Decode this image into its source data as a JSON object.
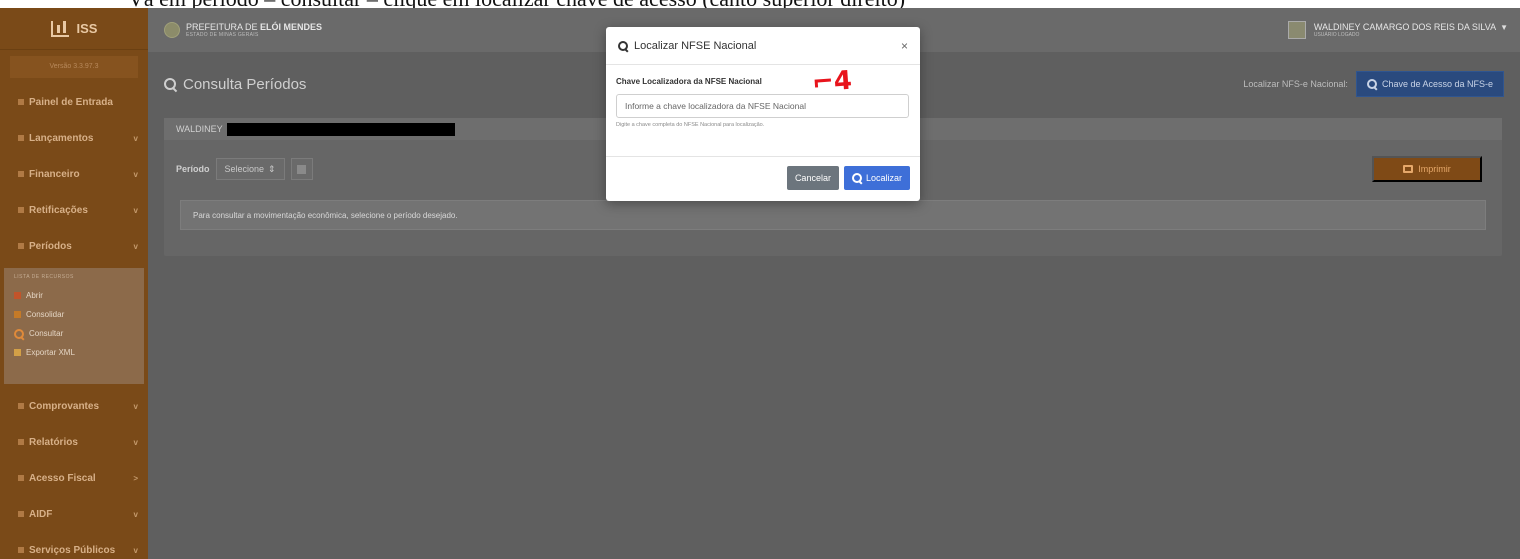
{
  "caption": "Vá em período – consultar – clique em localizar chave de acesso (canto superior direito)",
  "sidebar": {
    "app_name": "ISS",
    "version": "Versão 3.3.97.3",
    "items_top": [
      {
        "label": "Painel de Entrada",
        "chevron": ""
      },
      {
        "label": "Lançamentos",
        "chevron": "v"
      },
      {
        "label": "Financeiro",
        "chevron": "v"
      },
      {
        "label": "Retificações",
        "chevron": "v"
      },
      {
        "label": "Períodos",
        "chevron": "v"
      }
    ],
    "submenu": {
      "title": "LISTA DE RECURSOS",
      "items": [
        {
          "label": "Abrir",
          "icon": "red-square-icon"
        },
        {
          "label": "Consolidar",
          "icon": "orange-square-icon"
        },
        {
          "label": "Consultar",
          "icon": "search-icon"
        },
        {
          "label": "Exportar XML",
          "icon": "file-icon"
        }
      ]
    },
    "items_bottom": [
      {
        "label": "Comprovantes",
        "chevron": "v"
      },
      {
        "label": "Relatórios",
        "chevron": "v"
      },
      {
        "label": "Acesso Fiscal",
        "chevron": ">"
      },
      {
        "label": "AIDF",
        "chevron": "v"
      },
      {
        "label": "Serviços Públicos",
        "chevron": "v"
      }
    ]
  },
  "header": {
    "org_prefix": "PREFEITURA DE ",
    "org_name": "ELÓI MENDES",
    "org_state": "ESTADO DE MINAS GERAIS",
    "user_name": "WALDINEY CAMARGO DOS REIS DA SILVA",
    "user_role": "USUÁRIO LOGADO"
  },
  "main": {
    "page_title": "Consulta Períodos",
    "locate_label": "Localizar NFS-e Nacional:",
    "access_key_button": "Chave de Acesso da NFS-e",
    "card_owner": "WALDINEY",
    "period_label": "Período",
    "period_select": "Selecione",
    "print_button": "Imprimir",
    "notice": "Para consultar a movimentação econômica, selecione o período desejado."
  },
  "modal": {
    "title": "Localizar NFSE Nacional",
    "close": "×",
    "field_label": "Chave Localizadora da NFSE Nacional",
    "field_placeholder": "Informe a chave localizadora da NFSE Nacional",
    "field_value": "",
    "help": "Digite a chave completa do NFSE Nacional para localização.",
    "cancel_button": "Cancelar",
    "locate_button": "Localizar",
    "annotation": "⌐4"
  }
}
